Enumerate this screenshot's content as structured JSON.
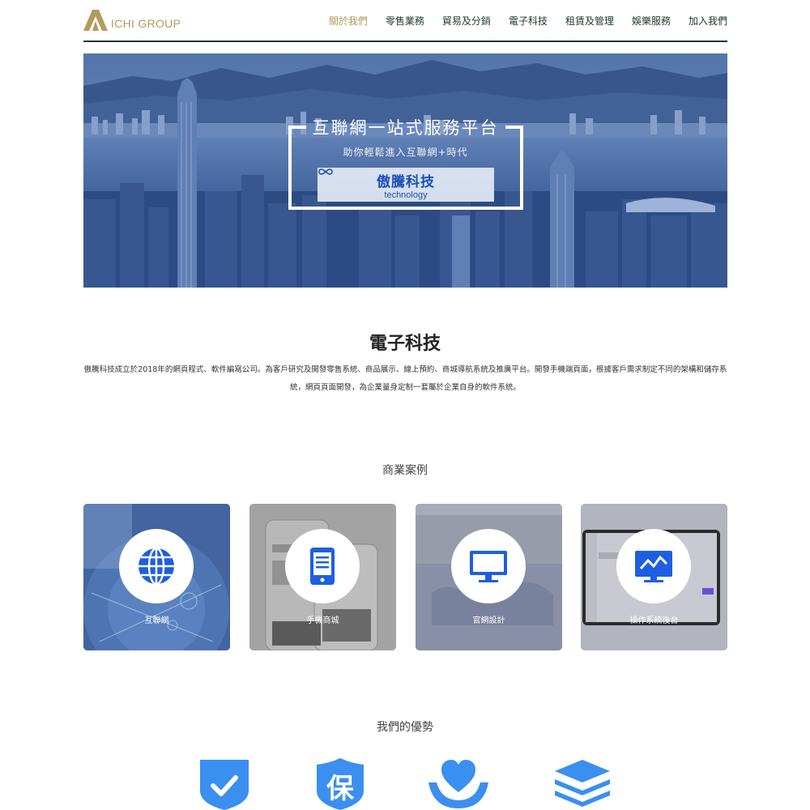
{
  "brand": {
    "name": "ICHI GROUP",
    "gold": "#b39a5c",
    "dark_green": "#1d3a28"
  },
  "nav": [
    {
      "label": "關於我們",
      "active": true
    },
    {
      "label": "零售業務",
      "active": false
    },
    {
      "label": "貿易及分銷",
      "active": false
    },
    {
      "label": "電子科技",
      "active": false
    },
    {
      "label": "租賃及管理",
      "active": false
    },
    {
      "label": "娛樂服務",
      "active": false
    },
    {
      "label": "加入我們",
      "active": false
    }
  ],
  "hero": {
    "title": "互聯網一站式服務平台",
    "subtitle": "助你輕鬆進入互聯網+時代",
    "badge_cn": "傲騰科技",
    "badge_en": "technology"
  },
  "intro": {
    "title": "電子科技",
    "text": "傲騰科技成立於2018年的網頁程式、軟件編寫公司。為客戶研究及開發零售系統、商品展示、線上預約、商城導航系統及推廣平台。開發手機端頁面，根據客戶需求制定不同的架構和儲存系統，網頁頁面開發，為企業量身定制一套屬於企業自身的軟件系統。"
  },
  "cases": {
    "title": "商業案例",
    "items": [
      {
        "label": "互聯網",
        "icon": "globe-icon"
      },
      {
        "label": "手機商城",
        "icon": "mobile-icon"
      },
      {
        "label": "官網設計",
        "icon": "monitor-icon"
      },
      {
        "label": "操作系統後台",
        "icon": "dashboard-chart-icon"
      }
    ]
  },
  "advantages": {
    "title": "我們的優勢",
    "icons": [
      "shield-check-icon",
      "shield-bao-icon",
      "heart-hands-icon",
      "layers-icon"
    ],
    "shield_char": "保",
    "color": "#3a8ff0"
  }
}
